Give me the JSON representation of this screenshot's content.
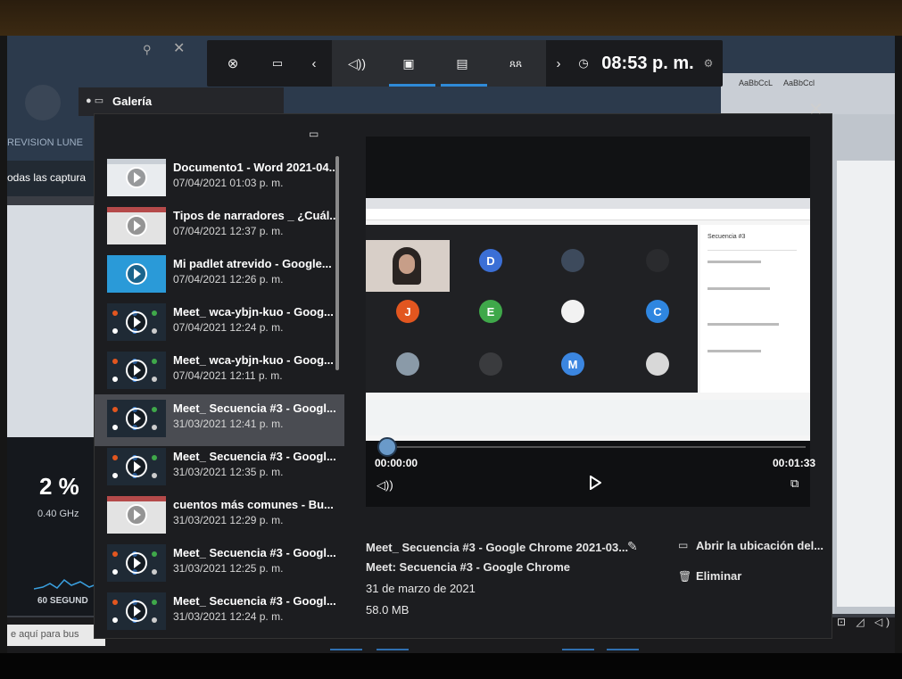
{
  "game_bar": {
    "time": "08:53 p. m."
  },
  "widget": {
    "title": "Galería"
  },
  "background": {
    "revision_text": "REVISION LUNE",
    "all_captures": "odas las captura",
    "cpu_percent": "2 %",
    "cpu_speed": "0.40 GHz",
    "seconds": "60 SEGUND",
    "search_text": "e aquí para bus",
    "ribbon_style_1": "AaBbCcL",
    "ribbon_style_2": "AaBbCcl"
  },
  "gallery": {
    "items": [
      {
        "title": "Documento1 - Word 2021-04...",
        "date": "07/04/2021 01:03 p. m.",
        "thumb": "word"
      },
      {
        "title": "Tipos de narradores _ ¿Cuál...",
        "date": "07/04/2021 12:37 p. m.",
        "thumb": "doc"
      },
      {
        "title": "Mi padlet atrevido - Google...",
        "date": "07/04/2021 12:26 p. m.",
        "thumb": "padlet"
      },
      {
        "title": "Meet_ wca-ybjn-kuo - Goog...",
        "date": "07/04/2021 12:24 p. m.",
        "thumb": "meet"
      },
      {
        "title": "Meet_ wca-ybjn-kuo - Goog...",
        "date": "07/04/2021 12:11 p. m.",
        "thumb": "meet"
      },
      {
        "title": "Meet_ Secuencia #3 - Googl...",
        "date": "31/03/2021 12:41 p. m.",
        "thumb": "meet",
        "selected": true
      },
      {
        "title": "Meet_ Secuencia #3 - Googl...",
        "date": "31/03/2021 12:35 p. m.",
        "thumb": "meet"
      },
      {
        "title": "cuentos más comunes - Bu...",
        "date": "31/03/2021 12:29 p. m.",
        "thumb": "doc"
      },
      {
        "title": "Meet_ Secuencia #3 - Googl...",
        "date": "31/03/2021 12:25 p. m.",
        "thumb": "meet"
      },
      {
        "title": "Meet_ Secuencia #3 - Googl...",
        "date": "31/03/2021 12:24 p. m.",
        "thumb": "meet"
      }
    ]
  },
  "player": {
    "current_time": "00:00:00",
    "total_time": "00:01:33",
    "progress": 0
  },
  "meet_preview": {
    "avatars": [
      {
        "letter": "D",
        "color": "#3b6fd6"
      },
      {
        "letter": "",
        "color": "#3d4a5c"
      },
      {
        "letter": "",
        "color": "#2a2b2e"
      },
      {
        "letter": "J",
        "color": "#e2561f"
      },
      {
        "letter": "E",
        "color": "#3fa84a"
      },
      {
        "letter": "",
        "color": "#f2f2f2"
      },
      {
        "letter": "C",
        "color": "#2f86e0"
      },
      {
        "letter": "",
        "color": "#8a9aa8"
      },
      {
        "letter": "",
        "color": "#3a3b3e"
      },
      {
        "letter": "M",
        "color": "#3b86e0"
      },
      {
        "letter": "",
        "color": "#d8d8d8"
      }
    ],
    "side_title": "Secuencia #3"
  },
  "details": {
    "file_name": "Meet_ Secuencia #3 - Google Chrome 2021-03...",
    "app_name": "Meet: Secuencia #3 - Google Chrome",
    "date": "31 de marzo de 2021",
    "size": "58.0 MB",
    "open_location": "Abrir la ubicación del...",
    "delete": "Eliminar"
  }
}
